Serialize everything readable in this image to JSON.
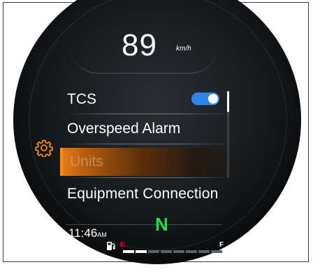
{
  "speedometer": {
    "value": "89",
    "unit": "km/h"
  },
  "menu": {
    "items": [
      {
        "label": "TCS",
        "control": "toggle",
        "toggle_on": true
      },
      {
        "label": "Overspeed Alarm"
      },
      {
        "label": "Units",
        "selected": true
      },
      {
        "label": "Equipment Connection"
      }
    ]
  },
  "status": {
    "time": "11:46",
    "meridiem": "AM",
    "gear": "N",
    "fuel": {
      "empty_label": "E",
      "full_label": "F",
      "filled_segments": 2,
      "total_segments": 8
    }
  },
  "icons": {
    "settings": "gear-icon",
    "fuel": "fuel-pump-icon"
  },
  "colors": {
    "accent_orange": "#ff8a1e",
    "toggle_blue": "#2f86ea",
    "gear_green": "#19e04a",
    "fuel_empty_red": "#e01a1a",
    "background": "#15181b"
  }
}
